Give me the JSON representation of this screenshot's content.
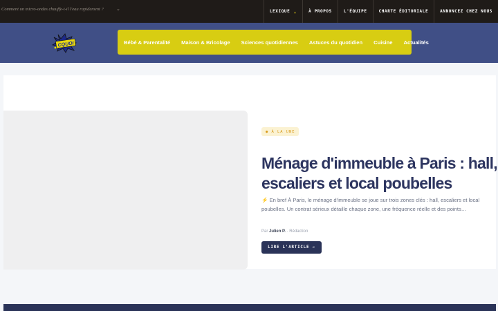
{
  "topbar": {
    "ticker_text": "Comment un micro-ondes chauffe-t-il l'eau rapidement ?",
    "ticker_icon": "chevron-down-icon",
    "nav": [
      {
        "label": "LEXIQUE",
        "has_dropdown": true
      },
      {
        "label": "À PROPOS"
      },
      {
        "label": "L'ÉQUIPE"
      },
      {
        "label": "CHARTE ÉDITORIALE"
      },
      {
        "label": "ANNONCEZ CHEZ NOUS"
      }
    ]
  },
  "logo": {
    "text": "CQUOI"
  },
  "categories": [
    "Bébé & Parentalité",
    "Maison & Bricolage",
    "Sciences quotidiennes",
    "Astuces du quotidien",
    "Cuisine",
    "Actualités"
  ],
  "featured": {
    "badge": "● À LA UNE",
    "title": "Ménage d'immeuble à Paris : hall, escaliers et local poubelles",
    "excerpt": "⚡ En bref À Paris, le ménage d'immeuble se joue sur trois zones clés : hall, escaliers et local poubelles. Un contrat sérieux détaille chaque zone, une fréquence réelle et des points…",
    "byline_prefix": "Par",
    "author": "Julien P.",
    "byline_sep": "·",
    "role": "Rédaction",
    "cta": "LIRE L'ARTICLE →"
  },
  "colors": {
    "topbar_bg": "#1f1b18",
    "header_bg": "#404f86",
    "accent_yellow": "#d8cd12",
    "navy": "#2a3358"
  }
}
